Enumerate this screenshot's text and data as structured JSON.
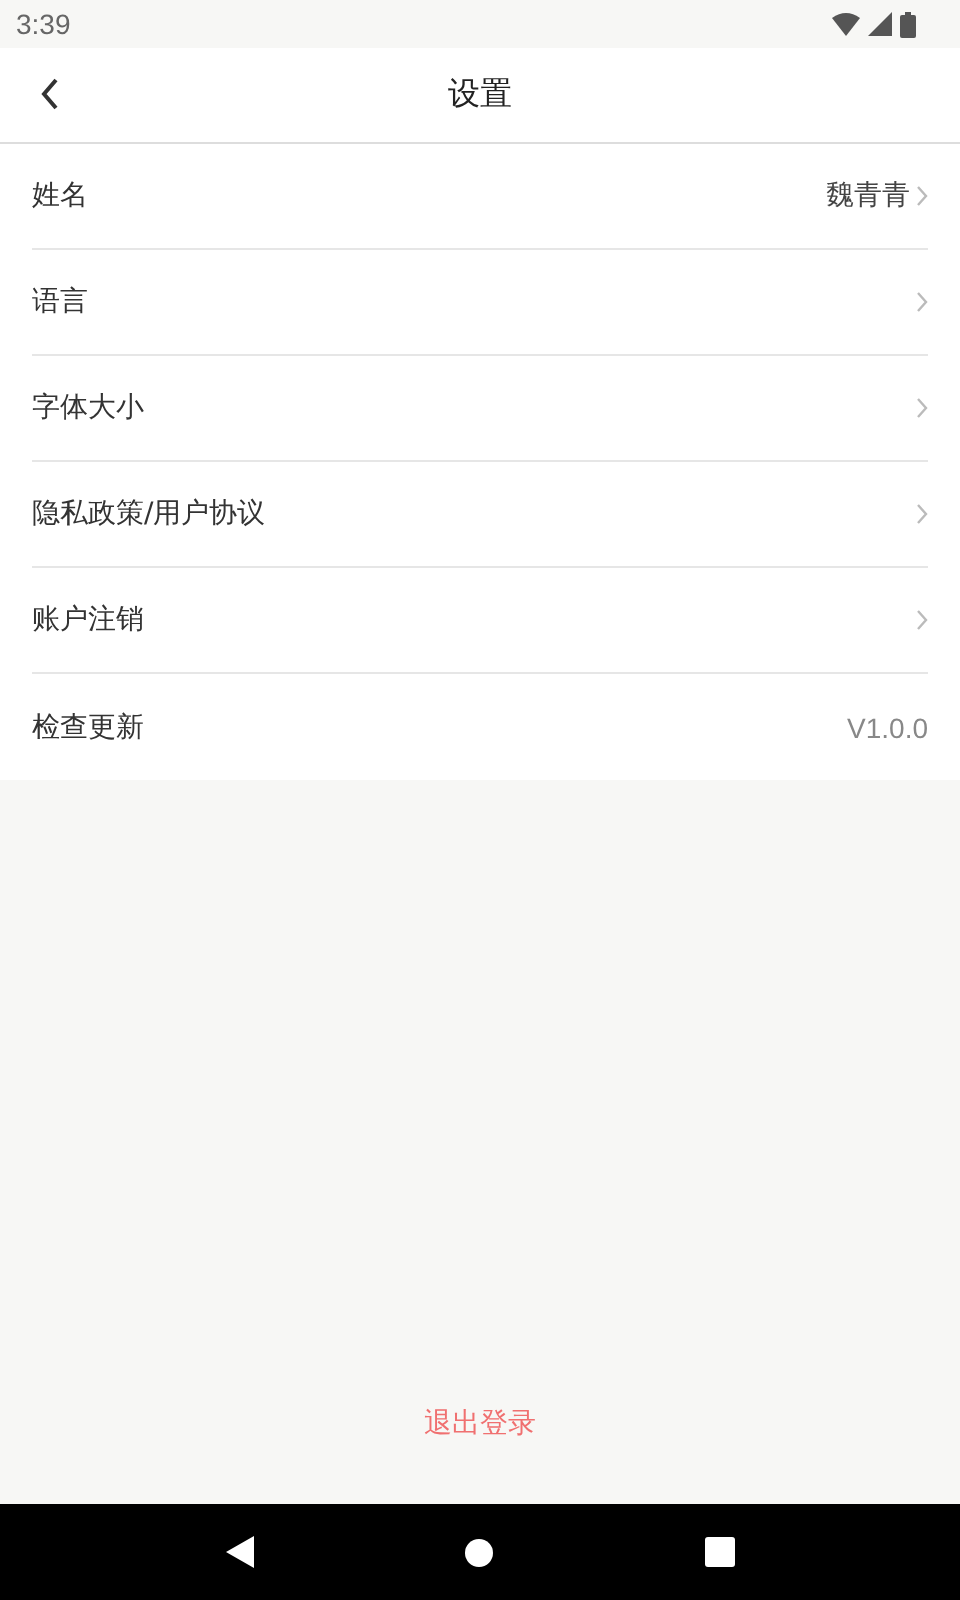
{
  "status_bar": {
    "time": "3:39"
  },
  "header": {
    "title": "设置"
  },
  "rows": [
    {
      "label": "姓名",
      "value": "魏青青",
      "kind": "link"
    },
    {
      "label": "语言",
      "kind": "link"
    },
    {
      "label": "字体大小",
      "kind": "link"
    },
    {
      "label": "隐私政策/用户协议",
      "kind": "link"
    },
    {
      "label": "账户注销",
      "kind": "link"
    },
    {
      "label": "检查更新",
      "value": "V1.0.0",
      "kind": "info"
    }
  ],
  "logout": {
    "label": "退出登录"
  }
}
